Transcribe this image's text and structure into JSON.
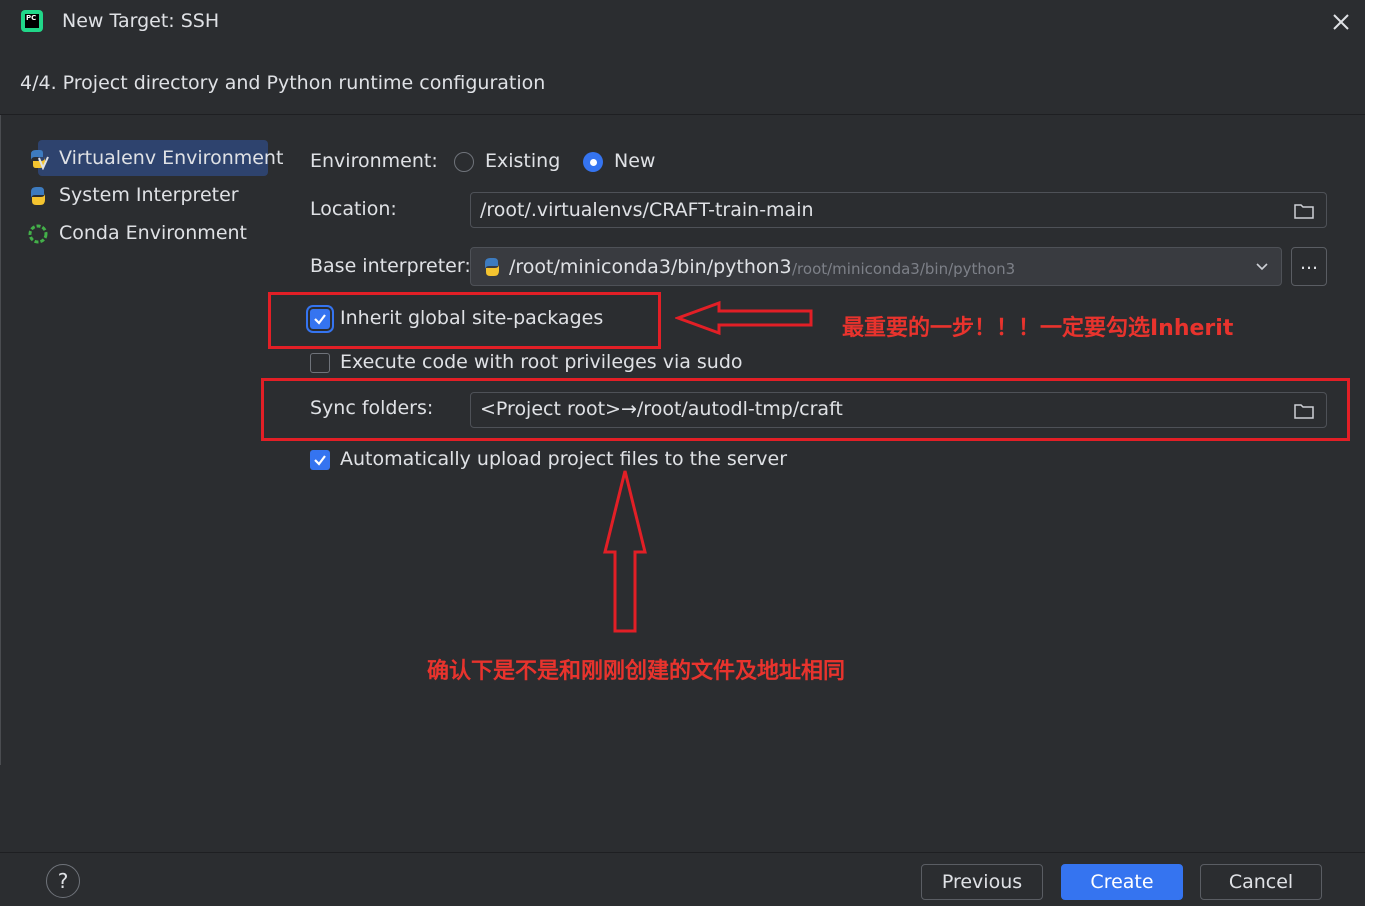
{
  "window": {
    "title": "New Target: SSH",
    "step": "4/4. Project directory and Python runtime configuration"
  },
  "sidebar": {
    "items": [
      {
        "label": "Virtualenv Environment",
        "icon": "virtualenv-icon",
        "selected": true
      },
      {
        "label": "System Interpreter",
        "icon": "python-icon",
        "selected": false
      },
      {
        "label": "Conda Environment",
        "icon": "conda-icon",
        "selected": false
      }
    ]
  },
  "form": {
    "environment_label": "Environment:",
    "radio_existing": "Existing",
    "radio_new": "New",
    "selected_environment": "New",
    "location_label": "Location:",
    "location_value": "/root/.virtualenvs/CRAFT-train-main",
    "base_interpreter_label": "Base interpreter:",
    "base_interpreter_value": "/root/miniconda3/bin/python3",
    "base_interpreter_hint": "/root/miniconda3/bin/python3",
    "browse_button": "...",
    "inherit_label": "Inherit global site-packages",
    "inherit_checked": true,
    "sudo_label": "Execute code with root privileges via sudo",
    "sudo_checked": false,
    "sync_label": "Sync folders:",
    "sync_value": "<Project root>→/root/autodl-tmp/craft",
    "upload_label": "Automatically upload project files to the server",
    "upload_checked": true
  },
  "annotations": {
    "inherit_note": "最重要的一步！！！一定要勾选Inherit",
    "sync_note": "确认下是不是和刚刚创建的文件及地址相同",
    "color": "#e21f26"
  },
  "footer": {
    "help": "?",
    "previous": "Previous",
    "create": "Create",
    "cancel": "Cancel"
  },
  "colors": {
    "background": "#2b2d30",
    "accent": "#3574f0",
    "text": "#dfe1e5"
  }
}
